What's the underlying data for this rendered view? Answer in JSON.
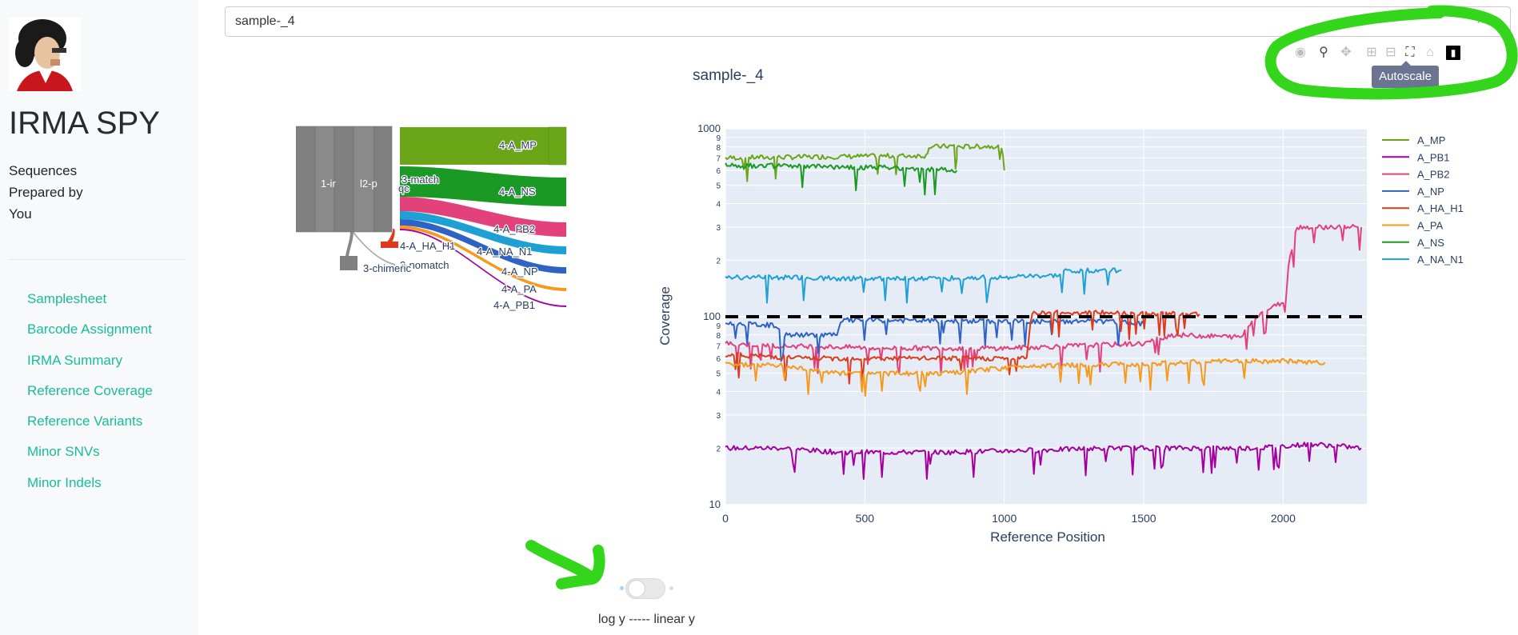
{
  "app": {
    "title": "IRMA SPY",
    "tagline": [
      "Sequences",
      "Prepared by",
      "You"
    ]
  },
  "sidebar": {
    "items": [
      {
        "label": "Samplesheet"
      },
      {
        "label": "Barcode Assignment"
      },
      {
        "label": "IRMA Summary"
      },
      {
        "label": "Reference Coverage"
      },
      {
        "label": "Reference Variants"
      },
      {
        "label": "Minor SNVs"
      },
      {
        "label": "Minor Indels"
      }
    ]
  },
  "sample_select": {
    "value": "sample-_4",
    "clear_icon": "×",
    "arrow_icon": "⌄"
  },
  "sankey": {
    "labels": {
      "root": "1-ir",
      "pass": "l2-p",
      "qc": "qc",
      "match": "3-match",
      "nomatch": "3-nomatch",
      "chimeric": "3-chimeric",
      "mp": "4-A_MP",
      "ns": "4-A_NS",
      "pb2": "4-A_PB2",
      "na": "4-A_NA_N1",
      "np": "4-A_NP",
      "pa": "4-A_PA",
      "pb1": "4-A_PB1",
      "ha": "4-A_HA_H1"
    }
  },
  "modebar": {
    "buttons": [
      "camera-icon",
      "zoom-icon",
      "pan-icon",
      "zoom-in-icon",
      "zoom-out-icon",
      "autoscale-icon",
      "home-icon",
      "plotly-logo-icon"
    ],
    "tooltip": "Autoscale"
  },
  "toggle": {
    "label": "log y ----- linear y",
    "state": "log"
  },
  "chart_data": {
    "type": "line",
    "title": "sample-_4",
    "xlabel": "Reference Position",
    "ylabel": "Coverage",
    "xlim": [
      0,
      2300
    ],
    "ylim": [
      10,
      1000
    ],
    "y_scale": "log",
    "x_ticks": [
      0,
      500,
      1000,
      1500,
      2000
    ],
    "y_tick_labels": [
      {
        "value": 10,
        "label": "10"
      },
      {
        "value": 20,
        "label": "2"
      },
      {
        "value": 30,
        "label": "3"
      },
      {
        "value": 40,
        "label": "4"
      },
      {
        "value": 50,
        "label": "5"
      },
      {
        "value": 60,
        "label": "6"
      },
      {
        "value": 70,
        "label": "7"
      },
      {
        "value": 80,
        "label": "8"
      },
      {
        "value": 90,
        "label": "9"
      },
      {
        "value": 100,
        "label": "100"
      },
      {
        "value": 200,
        "label": "2"
      },
      {
        "value": 300,
        "label": "3"
      },
      {
        "value": 400,
        "label": "4"
      },
      {
        "value": 500,
        "label": "5"
      },
      {
        "value": 600,
        "label": "6"
      },
      {
        "value": 700,
        "label": "7"
      },
      {
        "value": 800,
        "label": "8"
      },
      {
        "value": 900,
        "label": "9"
      },
      {
        "value": 1000,
        "label": "1000"
      }
    ],
    "threshold": {
      "value": 100,
      "style": "dashed",
      "color": "#000000"
    },
    "legend_position": "right",
    "grid": true,
    "series": [
      {
        "name": "A_MP",
        "color": "#6aa618",
        "points": [
          [
            0,
            700
          ],
          [
            720,
            720
          ],
          [
            730,
            800
          ],
          [
            820,
            810
          ],
          [
            830,
            700
          ],
          [
            830,
            800
          ],
          [
            990,
            810
          ],
          [
            1000,
            600
          ]
        ]
      },
      {
        "name": "A_PB1",
        "color": "#a3009f",
        "points": [
          [
            0,
            20
          ],
          [
            200,
            20
          ],
          [
            400,
            19
          ],
          [
            800,
            19
          ],
          [
            1400,
            20
          ],
          [
            1900,
            20
          ],
          [
            2100,
            21
          ],
          [
            2200,
            20.5
          ],
          [
            2280,
            20
          ]
        ]
      },
      {
        "name": "A_PB2",
        "color": "#e2417a",
        "points": [
          [
            0,
            72
          ],
          [
            200,
            70
          ],
          [
            600,
            68
          ],
          [
            1000,
            68
          ],
          [
            1500,
            72
          ],
          [
            1600,
            80
          ],
          [
            1850,
            78
          ],
          [
            1900,
            100
          ],
          [
            1950,
            110
          ],
          [
            2000,
            120
          ],
          [
            2050,
            300
          ],
          [
            2280,
            300
          ]
        ]
      },
      {
        "name": "A_NP",
        "color": "#2e62c4",
        "points": [
          [
            0,
            92
          ],
          [
            180,
            90
          ],
          [
            200,
            80
          ],
          [
            400,
            80
          ],
          [
            420,
            96
          ],
          [
            800,
            95
          ],
          [
            1200,
            94
          ],
          [
            1300,
            95
          ],
          [
            1500,
            92
          ]
        ]
      },
      {
        "name": "A_HA_H1",
        "color": "#dd3b1c",
        "points": [
          [
            0,
            63
          ],
          [
            300,
            60
          ],
          [
            600,
            60
          ],
          [
            1000,
            60
          ],
          [
            1080,
            60
          ],
          [
            1100,
            105
          ],
          [
            1400,
            105
          ],
          [
            1700,
            103
          ]
        ]
      },
      {
        "name": "A_PA",
        "color": "#f59a1c",
        "points": [
          [
            0,
            56
          ],
          [
            200,
            55
          ],
          [
            400,
            50
          ],
          [
            800,
            50
          ],
          [
            1100,
            55
          ],
          [
            1500,
            56
          ],
          [
            1800,
            58
          ],
          [
            2000,
            58
          ],
          [
            2150,
            57
          ]
        ]
      },
      {
        "name": "A_NS",
        "color": "#1a9a24",
        "points": [
          [
            0,
            640
          ],
          [
            300,
            630
          ],
          [
            600,
            620
          ],
          [
            830,
            600
          ]
        ]
      },
      {
        "name": "A_NA_N1",
        "color": "#1ea0d5",
        "points": [
          [
            0,
            163
          ],
          [
            400,
            160
          ],
          [
            800,
            160
          ],
          [
            1200,
            165
          ],
          [
            1220,
            175
          ],
          [
            1420,
            177
          ]
        ]
      }
    ]
  }
}
